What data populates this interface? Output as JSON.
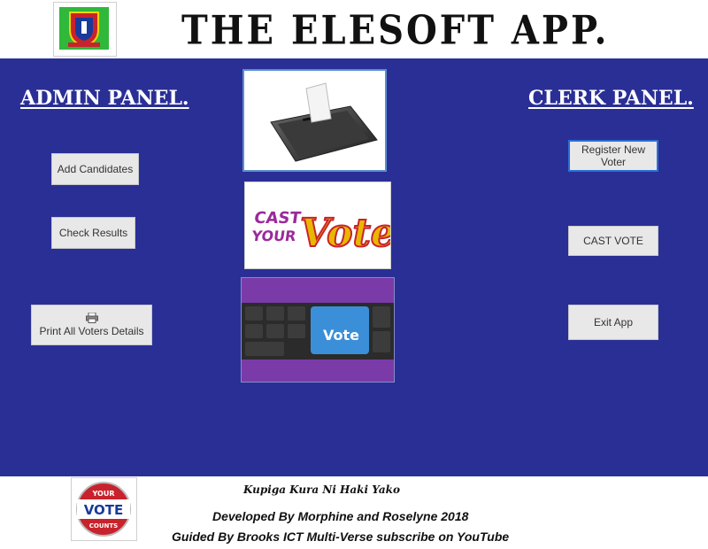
{
  "header": {
    "app_title": "THE ELESOFT APP."
  },
  "admin_panel": {
    "title": "ADMIN PANEL.",
    "add_candidates": "Add Candidates",
    "check_results": "Check Results",
    "print_voters": "Print All Voters Details"
  },
  "clerk_panel": {
    "title": "CLERK PANEL.",
    "register_voter": "Register New Voter",
    "cast_vote": "CAST VOTE",
    "exit_app": "Exit  App"
  },
  "images": {
    "cast_vote_top": "CAST",
    "cast_vote_mid": "YOUR",
    "cast_vote_word": "Vote",
    "keyboard_key": "Vote"
  },
  "footer": {
    "motto": "Kupiga Kura Ni Haki Yako",
    "badge_top": "YOUR",
    "badge_mid": "VOTE",
    "badge_bottom": "COUNTS",
    "developed_by": "Developed By Morphine and Roselyne 2018",
    "guided_by": "Guided By Brooks ICT Multi-Verse subscribe on YouTube"
  },
  "colors": {
    "main_bg": "#2a2f96",
    "button_bg": "#e8e8e8",
    "focus_border": "#2a6fd6"
  }
}
